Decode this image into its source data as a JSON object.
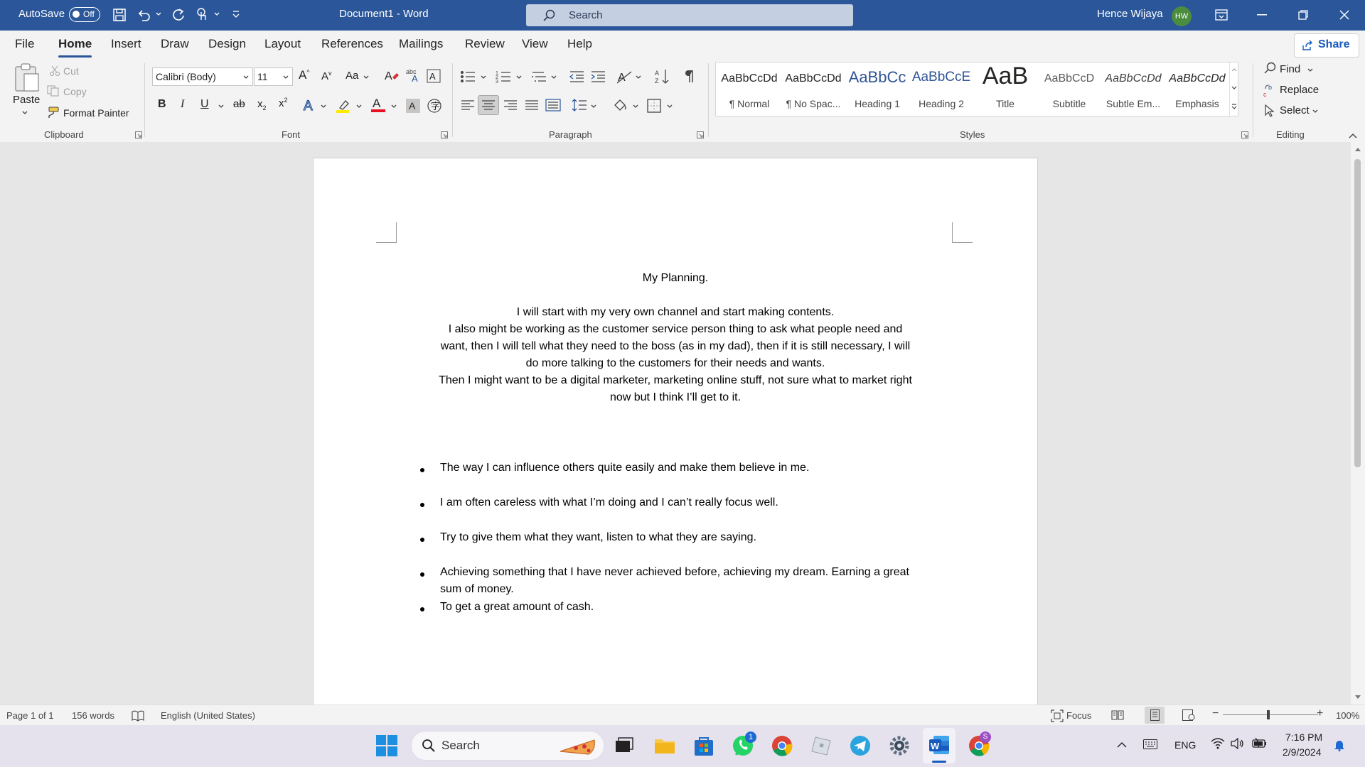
{
  "titlebar": {
    "autosave_label": "AutoSave",
    "autosave_state": "Off",
    "doc_title": "Document1  -  Word",
    "search_placeholder": "Search",
    "user_name": "Hence Wijaya",
    "user_initials": "HW"
  },
  "menu": {
    "tabs": [
      "File",
      "Home",
      "Insert",
      "Draw",
      "Design",
      "Layout",
      "References",
      "Mailings",
      "Review",
      "View",
      "Help"
    ],
    "active": "Home",
    "share_label": "Share"
  },
  "ribbon": {
    "clipboard": {
      "paste": "Paste",
      "cut": "Cut",
      "copy": "Copy",
      "format_painter": "Format Painter",
      "label": "Clipboard"
    },
    "font": {
      "font_name": "Calibri (Body)",
      "font_size": "11",
      "case_label": "Aa",
      "label": "Font"
    },
    "paragraph": {
      "label": "Paragraph"
    },
    "styles": {
      "label": "Styles",
      "items": [
        {
          "preview": "AaBbCcDd",
          "name": "¶ Normal"
        },
        {
          "preview": "AaBbCcDd",
          "name": "¶ No Spac..."
        },
        {
          "preview": "AaBbCc",
          "name": "Heading 1"
        },
        {
          "preview": "AaBbCcE",
          "name": "Heading 2"
        },
        {
          "preview": "AaB",
          "name": "Title"
        },
        {
          "preview": "AaBbCcD",
          "name": "Subtitle"
        },
        {
          "preview": "AaBbCcDd",
          "name": "Subtle Em..."
        },
        {
          "preview": "AaBbCcDd",
          "name": "Emphasis"
        }
      ]
    },
    "editing": {
      "find": "Find",
      "replace": "Replace",
      "select": "Select",
      "label": "Editing"
    }
  },
  "document": {
    "title": "My Planning.",
    "paragraph_lines": [
      "I will start with my very own channel and start making contents.",
      "I also might be working as the customer service person thing to ask what people need and",
      "want, then I will tell what they need to the boss (as in my dad), then if it is still necessary, I will",
      "do more talking to the customers for their needs and wants.",
      "Then I might want to be a digital marketer, marketing online stuff, not sure what to market right",
      "now but I think I’ll get to it."
    ],
    "bullets": [
      {
        "lines": [
          "The way I can influence others quite easily and make them believe in me."
        ]
      },
      {
        "lines": [
          "I am often careless with what I’m doing and I can’t really focus well."
        ]
      },
      {
        "lines": [
          "Try to give them what they want, listen to what they are saying."
        ]
      },
      {
        "lines": [
          "Achieving something that I have never achieved before, achieving my dream. Earning a great",
          "sum of money."
        ]
      },
      {
        "lines": [
          "To get a great amount of cash."
        ]
      }
    ]
  },
  "statusbar": {
    "page": "Page 1 of 1",
    "words": "156 words",
    "language": "English (United States)",
    "focus": "Focus",
    "zoom": "100%",
    "zoom_minus": "−",
    "zoom_plus": "+"
  },
  "taskbar": {
    "search_placeholder": "Search",
    "whatsapp_badge": "1",
    "chrome_badge": "S",
    "language": "ENG",
    "time": "7:16 PM",
    "date": "2/9/2024"
  }
}
